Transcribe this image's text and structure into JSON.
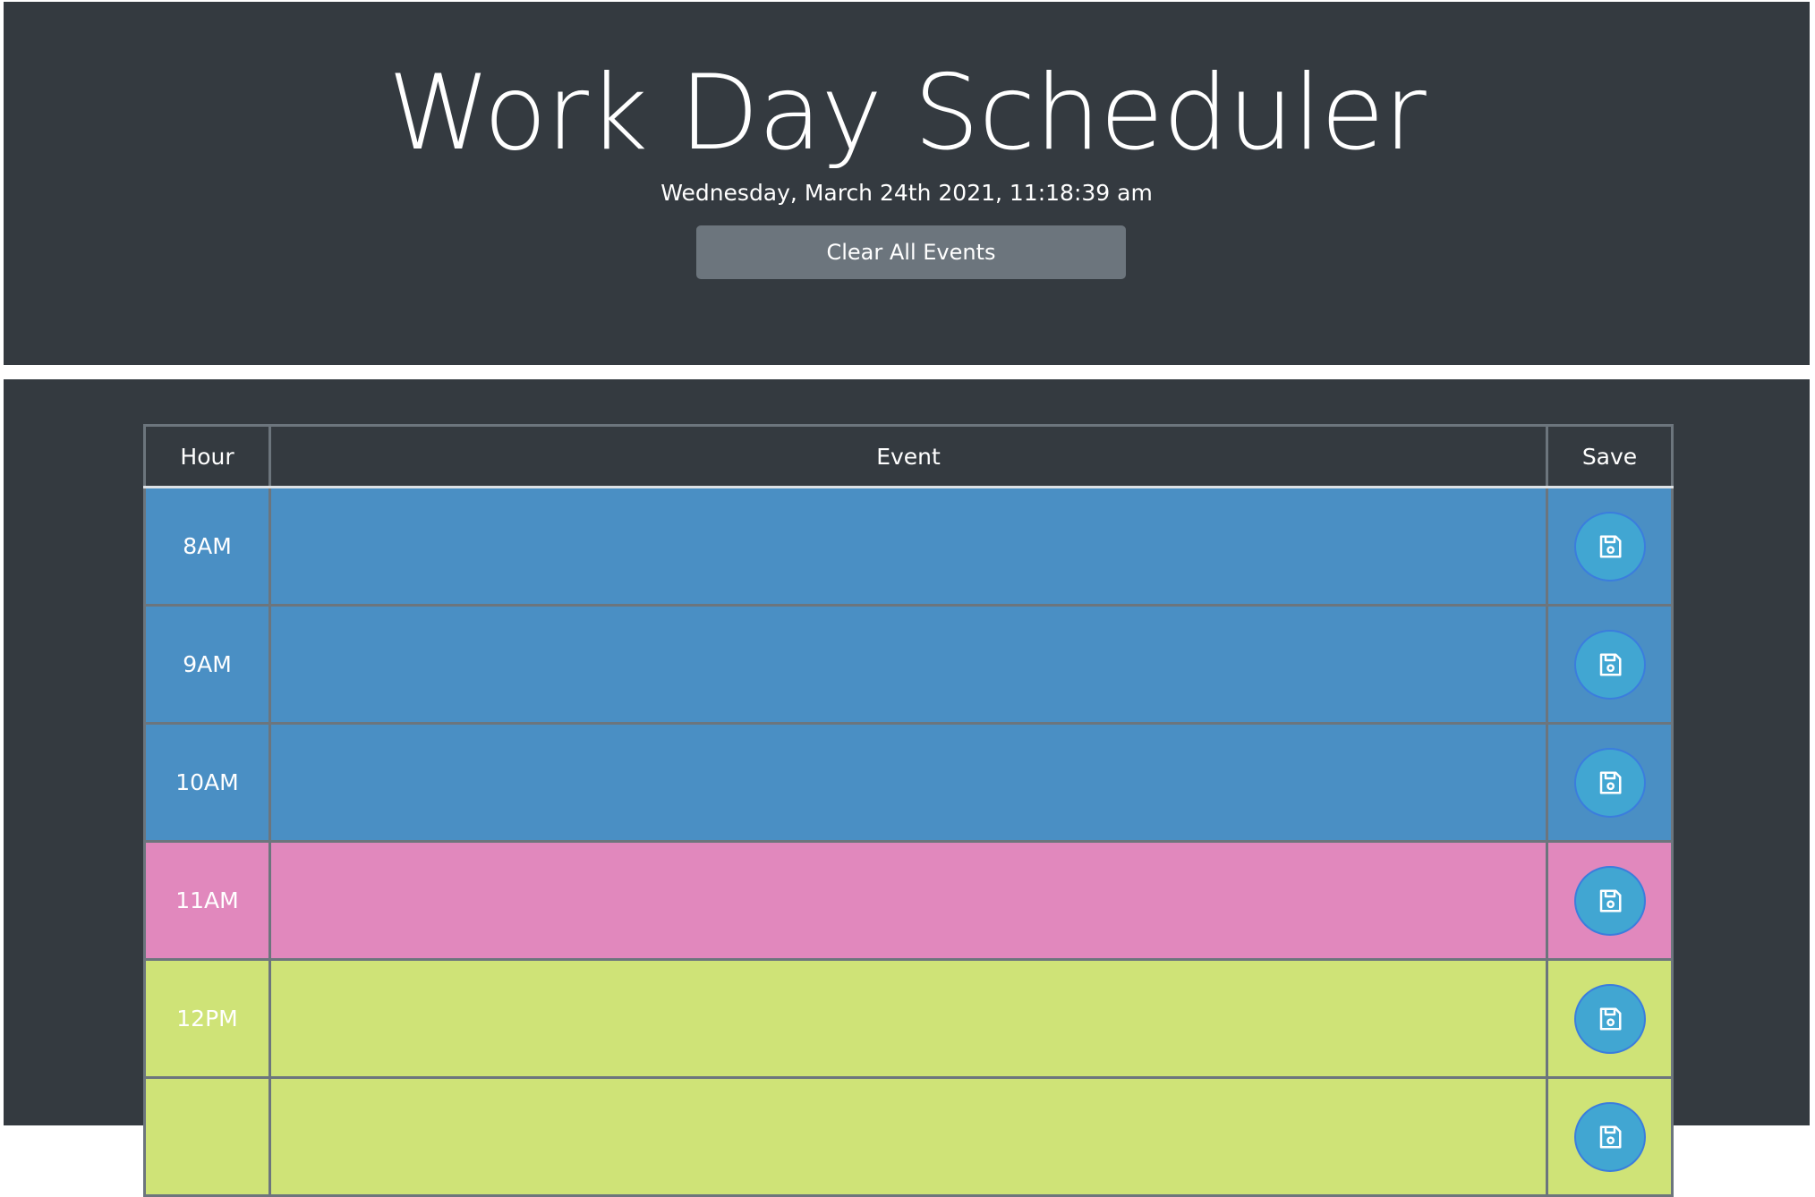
{
  "app": {
    "title": "Work Day Scheduler",
    "datetime": "Wednesday, March 24th 2021, 11:18:39 am",
    "clear_button_label": "Clear All Events"
  },
  "table": {
    "headers": {
      "hour": "Hour",
      "event": "Event",
      "save": "Save"
    },
    "rows": [
      {
        "hour": "8AM",
        "event": "",
        "status": "past"
      },
      {
        "hour": "9AM",
        "event": "",
        "status": "past"
      },
      {
        "hour": "10AM",
        "event": "",
        "status": "past"
      },
      {
        "hour": "11AM",
        "event": "",
        "status": "present"
      },
      {
        "hour": "12PM",
        "event": "",
        "status": "future"
      },
      {
        "hour": "",
        "event": "",
        "status": "future"
      }
    ],
    "save_icon": "floppy-disk-icon"
  },
  "colors": {
    "background": "#343a40",
    "past": "#4a8fc4",
    "present": "#e188bd",
    "future": "#cfe377",
    "clear_button": "#6c757d",
    "save_button": "#41a6d2"
  }
}
